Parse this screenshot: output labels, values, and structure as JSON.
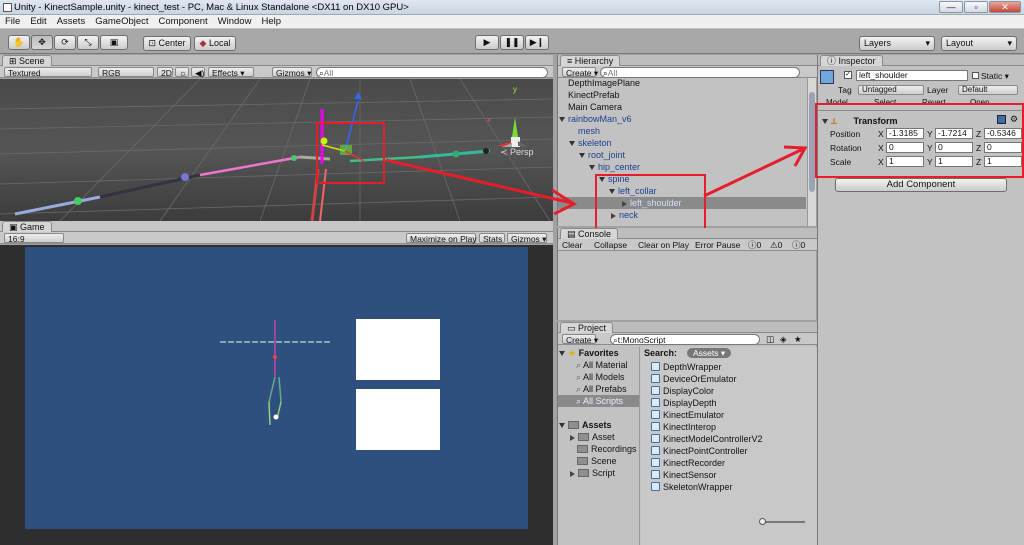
{
  "window": {
    "title": "Unity - KinectSample.unity - kinect_test - PC, Mac & Linux Standalone <DX11 on DX10 GPU>"
  },
  "menu": [
    "File",
    "Edit",
    "Assets",
    "GameObject",
    "Component",
    "Window",
    "Help"
  ],
  "toolbar": {
    "pivot": "Center",
    "space": "Local",
    "layers": "Layers",
    "layout": "Layout"
  },
  "scene": {
    "tab": "Scene",
    "shading": "Textured",
    "render": "RGB",
    "mode2d": "2D",
    "effects": "Effects",
    "gizmos": "Gizmos",
    "search_placeholder": "All",
    "persp": "Persp",
    "axis_x": "x",
    "axis_y": "y"
  },
  "game": {
    "tab": "Game",
    "aspect": "16:9",
    "maximize": "Maximize on Play",
    "stats": "Stats",
    "gizmos": "Gizmos"
  },
  "hierarchy": {
    "tab": "Hierarchy",
    "create": "Create",
    "search_placeholder": "All",
    "items": [
      {
        "label": "DepthImagePlane"
      },
      {
        "label": "KinectPrefab"
      },
      {
        "label": "Main Camera"
      },
      {
        "label": "rainbowMan_v6"
      },
      {
        "label": "mesh"
      },
      {
        "label": "skeleton"
      },
      {
        "label": "root_joint"
      },
      {
        "label": "hip_center"
      },
      {
        "label": "spine"
      },
      {
        "label": "left_collar"
      },
      {
        "label": "left_shoulder"
      },
      {
        "label": "neck"
      }
    ]
  },
  "console": {
    "tab": "Console",
    "buttons": [
      "Clear",
      "Collapse",
      "Clear on Play",
      "Error Pause"
    ],
    "counts": [
      "0",
      "0",
      "0"
    ]
  },
  "project": {
    "tab": "Project",
    "create": "Create",
    "search_value": "t:MonoScript",
    "favorites_title": "Favorites",
    "favorites": [
      "All Material",
      "All Models",
      "All Prefabs",
      "All Scripts"
    ],
    "assets_title": "Assets",
    "folders": [
      "Asset",
      "Recordings",
      "Scene",
      "Script"
    ],
    "search_label": "Search:",
    "search_scope": "Assets",
    "scripts": [
      "DepthWrapper",
      "DeviceOrEmulator",
      "DisplayColor",
      "DisplayDepth",
      "KinectEmulator",
      "KinectInterop",
      "KinectModelControllerV2",
      "KinectPointController",
      "KinectRecorder",
      "KinectSensor",
      "SkeletonWrapper"
    ]
  },
  "inspector": {
    "tab": "Inspector",
    "object_name": "left_shoulder",
    "static": "Static",
    "tag_label": "Tag",
    "tag": "Untagged",
    "layer_label": "Layer",
    "layer": "Default",
    "prefab_buttons": [
      "Model",
      "Select",
      "Revert",
      "Open"
    ],
    "component": "Transform",
    "position_label": "Position",
    "rotation_label": "Rotation",
    "scale_label": "Scale",
    "x": "X",
    "y": "Y",
    "z": "Z",
    "position": {
      "x": "-1.3185",
      "y": "-1.7214",
      "z": "-0.5346"
    },
    "rotation": {
      "x": "0",
      "y": "0",
      "z": "0"
    },
    "scale": {
      "x": "1",
      "y": "1",
      "z": "1"
    },
    "add_component": "Add Component"
  },
  "colors": {
    "annotation": "#e41e2a",
    "game_bg": "#2f4f7f",
    "selection": "#8a8a8a"
  }
}
